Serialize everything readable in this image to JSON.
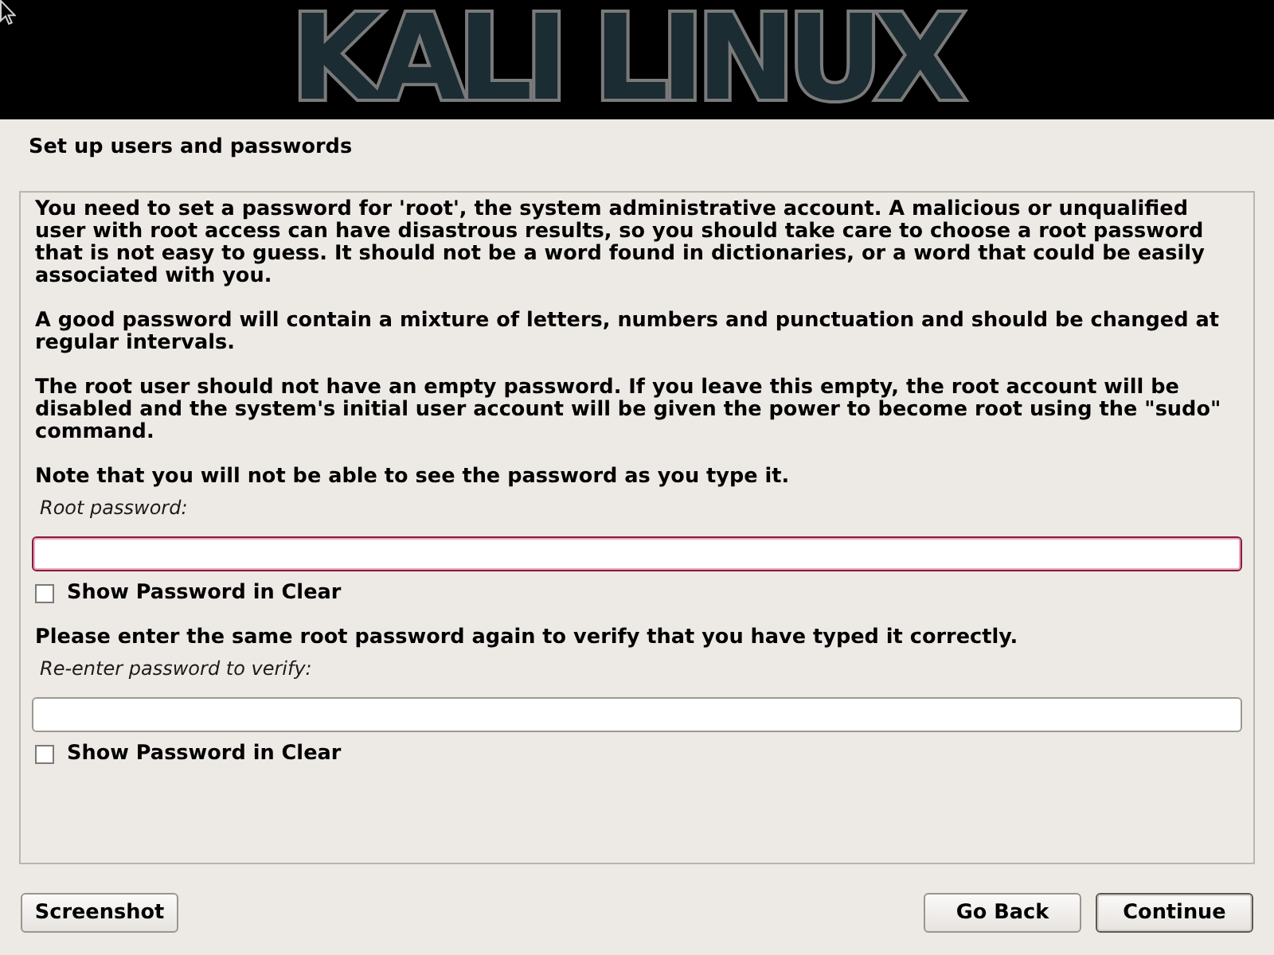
{
  "banner": {
    "logo_text": "KALI LINUX"
  },
  "page": {
    "title": "Set up users and passwords"
  },
  "content": [
    {
      "kind": "paragraph",
      "text": "You need to set a password for 'root', the system administrative account. A malicious or unqualified user with root access can have disastrous results, so you should take care to choose a root password that is not easy to guess. It should not be a word found in dictionaries, or a word that could be easily associated with you."
    },
    {
      "kind": "paragraph",
      "text": "A good password will contain a mixture of letters, numbers and punctuation and should be changed at regular intervals."
    },
    {
      "kind": "paragraph",
      "text": "The root user should not have an empty password. If you leave this empty, the root account will be disabled and the system's initial user account will be given the power to become root using the \"sudo\" command."
    },
    {
      "kind": "paragraph",
      "text": "Note that you will not be able to see the password as you type it."
    },
    {
      "kind": "field",
      "label": "Root password:",
      "focused": true
    },
    {
      "kind": "checkbox",
      "label": "Show Password in Clear",
      "checked": false
    },
    {
      "kind": "paragraph",
      "text": "Please enter the same root password again to verify that you have typed it correctly."
    },
    {
      "kind": "field",
      "label": "Re-enter password to verify:",
      "focused": false
    },
    {
      "kind": "checkbox",
      "label": "Show Password in Clear",
      "checked": false
    }
  ],
  "buttons": [
    {
      "label": "Screenshot",
      "default": false
    },
    {
      "label": "Go Back",
      "default": false
    },
    {
      "label": "Continue",
      "default": true
    }
  ]
}
